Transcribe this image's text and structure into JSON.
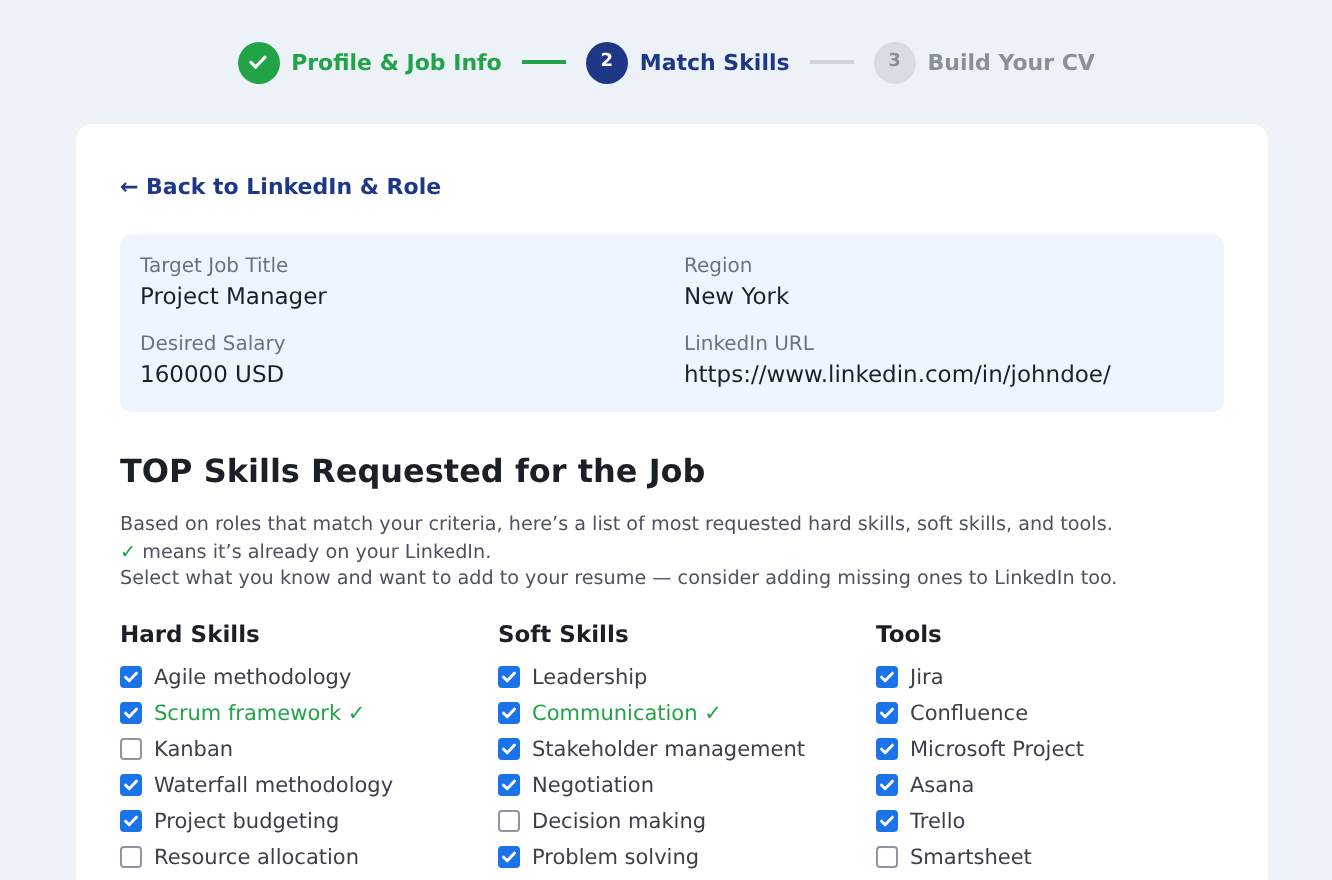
{
  "steps": [
    {
      "label": "Profile & Job Info",
      "done": true,
      "current": false
    },
    {
      "number": "2",
      "label": "Match Skills",
      "done": false,
      "current": true
    },
    {
      "number": "3",
      "label": "Build Your CV",
      "done": false,
      "current": false
    }
  ],
  "back_link": "← Back to LinkedIn & Role",
  "summary": [
    {
      "label": "Target Job Title",
      "value": "Project Manager"
    },
    {
      "label": "Region",
      "value": "New York"
    },
    {
      "label": "Desired Salary",
      "value": "160000 USD"
    },
    {
      "label": "LinkedIn URL",
      "value": "https://www.linkedin.com/in/johndoe/"
    }
  ],
  "section_title": "TOP Skills Requested for the Job",
  "intro": "Based on roles that match your criteria, here’s a list of most requested hard skills, soft skills, and tools.",
  "legend": {
    "mark": "✓",
    "text": "means it’s already on your LinkedIn."
  },
  "instruction": "Select what you know and want to add to your resume — consider adding missing ones to LinkedIn too.",
  "columns": [
    {
      "title": "Hard Skills",
      "items": [
        {
          "label": "Agile methodology",
          "checked": true,
          "on_linkedin": false
        },
        {
          "label": "Scrum framework",
          "checked": true,
          "on_linkedin": true,
          "mark": "✓"
        },
        {
          "label": "Kanban",
          "checked": false,
          "on_linkedin": false
        },
        {
          "label": "Waterfall methodology",
          "checked": true,
          "on_linkedin": false
        },
        {
          "label": "Project budgeting",
          "checked": true,
          "on_linkedin": false
        },
        {
          "label": "Resource allocation",
          "checked": false,
          "on_linkedin": false
        }
      ]
    },
    {
      "title": "Soft Skills",
      "items": [
        {
          "label": "Leadership",
          "checked": true,
          "on_linkedin": false
        },
        {
          "label": "Communication",
          "checked": true,
          "on_linkedin": true,
          "mark": "✓"
        },
        {
          "label": "Stakeholder management",
          "checked": true,
          "on_linkedin": false
        },
        {
          "label": "Negotiation",
          "checked": true,
          "on_linkedin": false
        },
        {
          "label": "Decision making",
          "checked": false,
          "on_linkedin": false
        },
        {
          "label": "Problem solving",
          "checked": true,
          "on_linkedin": false
        }
      ]
    },
    {
      "title": "Tools",
      "items": [
        {
          "label": "Jira",
          "checked": true,
          "on_linkedin": false
        },
        {
          "label": "Confluence",
          "checked": true,
          "on_linkedin": false
        },
        {
          "label": "Microsoft Project",
          "checked": true,
          "on_linkedin": false
        },
        {
          "label": "Asana",
          "checked": true,
          "on_linkedin": false
        },
        {
          "label": "Trello",
          "checked": true,
          "on_linkedin": false
        },
        {
          "label": "Smartsheet",
          "checked": false,
          "on_linkedin": false
        }
      ]
    }
  ]
}
